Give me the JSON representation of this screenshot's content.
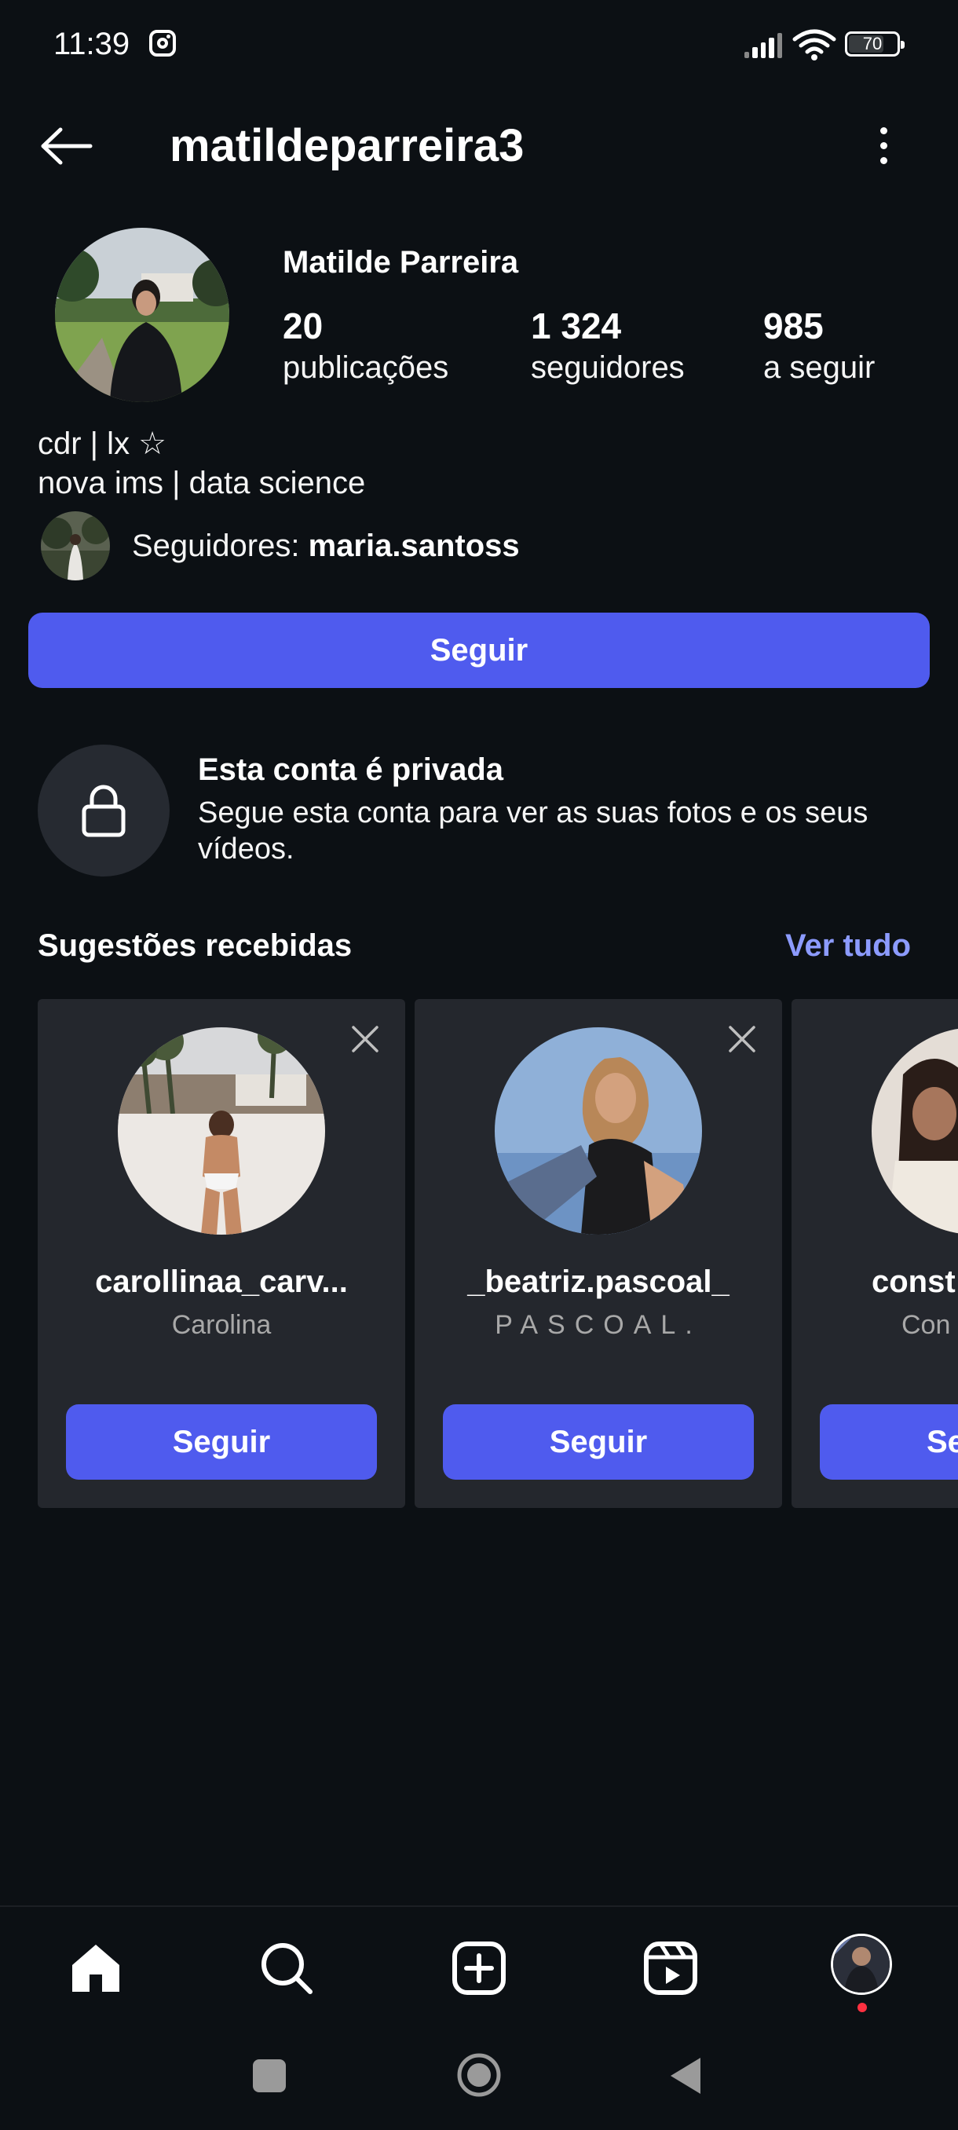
{
  "status_bar": {
    "time": "11:39",
    "battery": "70",
    "icons": [
      "instagram-icon",
      "signal-icon",
      "wifi-icon",
      "battery-icon"
    ]
  },
  "header": {
    "username": "matildeparreira3",
    "back_icon": "arrow-left-icon",
    "more_icon": "more-vertical-icon"
  },
  "profile": {
    "display_name": "Matilde Parreira",
    "stats": [
      {
        "value": "20",
        "label": "publicações"
      },
      {
        "value": "1 324",
        "label": "seguidores"
      },
      {
        "value": "985",
        "label": "a seguir"
      }
    ],
    "bio_line1": "cdr | lx ☆",
    "bio_line2": "nova ims | data science",
    "followers_prefix": "Seguidores: ",
    "followers_name": "maria.santoss",
    "follow_label": "Seguir"
  },
  "private": {
    "title": "Esta conta é privada",
    "text": "Segue esta conta para ver as suas fotos e os seus vídeos.",
    "icon": "lock-icon"
  },
  "suggestions": {
    "title": "Sugestões recebidas",
    "see_all": "Ver tudo",
    "cards": [
      {
        "username": "carollinaa_carv...",
        "name": "Carolina",
        "button": "Seguir"
      },
      {
        "username": "_beatriz.pascoal_",
        "name": "PASCOAL.",
        "button": "Seguir"
      },
      {
        "username": "const",
        "name": "Con",
        "button": "Se"
      }
    ]
  },
  "bottom_nav": [
    "home-icon",
    "search-icon",
    "create-icon",
    "reels-icon",
    "profile-avatar"
  ],
  "colors": {
    "background": "#0c1014",
    "accent": "#4f5bee",
    "link": "#8c9bff",
    "card": "#24272d",
    "notification": "#ff3040"
  }
}
